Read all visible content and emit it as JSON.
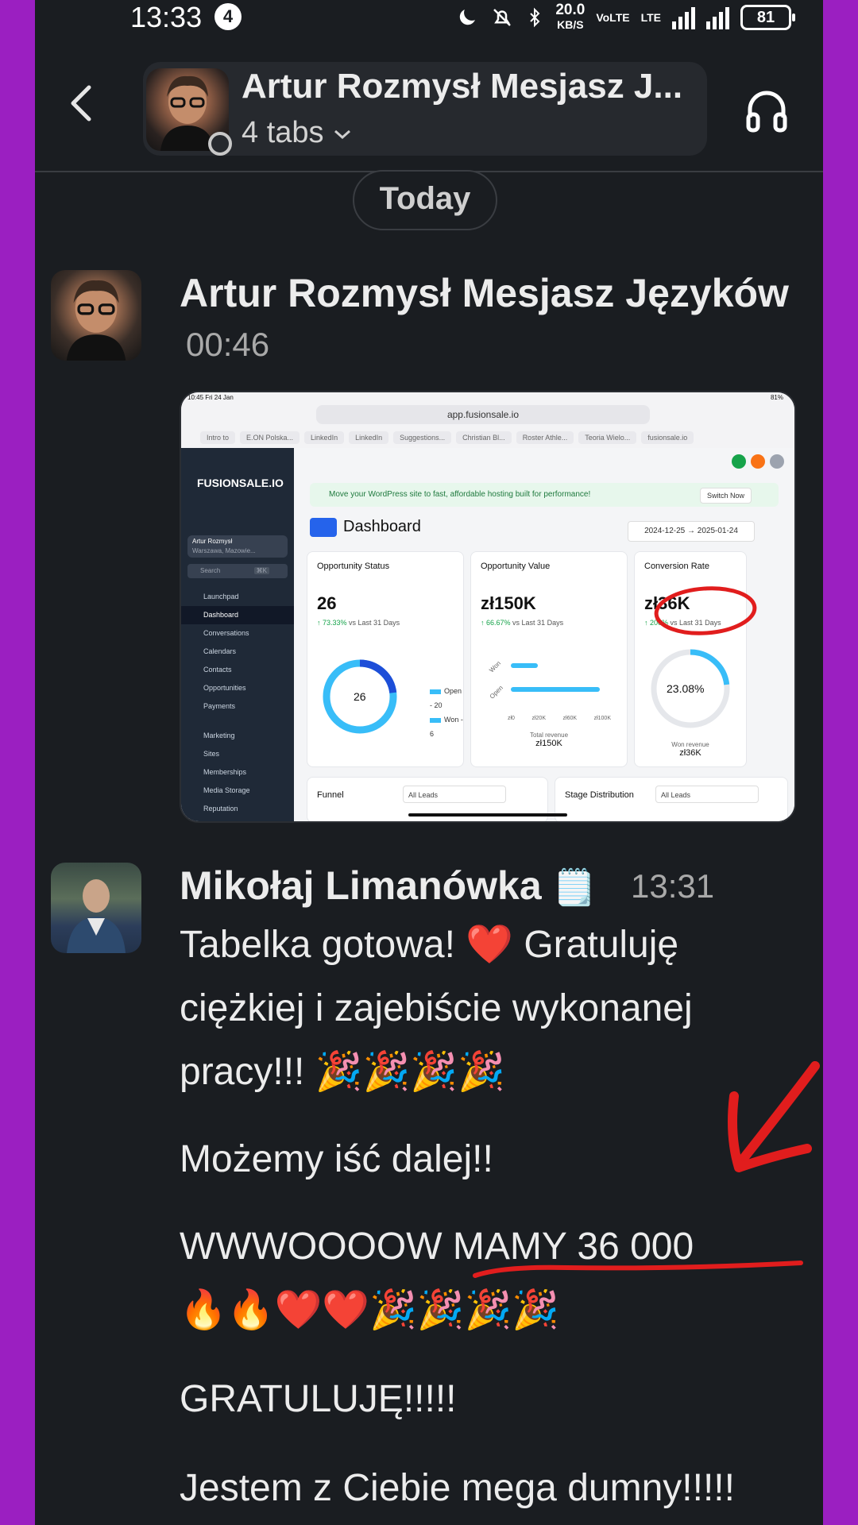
{
  "status_bar": {
    "time": "13:33",
    "notification_count": "4",
    "speed_value": "20.0",
    "speed_unit": "KB/S",
    "volte": "VoLTE",
    "lte": "LTE",
    "battery": "81"
  },
  "header": {
    "title": "Artur Rozmysł Mesjasz J...",
    "subtitle": "4 tabs"
  },
  "date_divider": "Today",
  "messages": [
    {
      "author": "Artur Rozmysł Mesjasz Języków",
      "time": "00:46",
      "screenshot": {
        "status_time": "10:45  Fri 24 Jan",
        "url": "app.fusionsale.io",
        "battery": "81%",
        "tabs": [
          "Intro to",
          "E.ON Polska...",
          "LinkedIn",
          "LinkedIn",
          "Suggestions...",
          "Christian Bl...",
          "Roster Athle...",
          "Teoria Wielo...",
          "fusionsale.io"
        ],
        "logo": "FUSIONSALE.IO",
        "user_name": "Artur Rozmysł",
        "user_location": "Warszawa, Mazowie...",
        "search_placeholder": "Search",
        "search_shortcut": "⌘K",
        "nav_items": [
          "Launchpad",
          "Dashboard",
          "Conversations",
          "Calendars",
          "Contacts",
          "Opportunities",
          "Payments"
        ],
        "nav_items_2": [
          "Marketing",
          "Sites",
          "Memberships",
          "Media Storage",
          "Reputation"
        ],
        "banner": "Move your WordPress site to fast, affordable hosting built for performance!",
        "banner_button": "Switch Now",
        "page_title": "Dashboard",
        "date_from": "2024-12-25",
        "date_to": "2025-01-24",
        "cards": [
          {
            "title": "Opportunity Status",
            "value": "26",
            "change": "↑ 73.33%",
            "compare": "vs Last 31 Days",
            "donut_label": "26",
            "legend": [
              "Open - 20",
              "Won - 6"
            ]
          },
          {
            "title": "Opportunity Value",
            "value": "zł150K",
            "change": "↑ 66.67%",
            "compare": "vs Last 31 Days",
            "axis": [
              "zł0",
              "zł20K",
              "zł60K",
              "zł100K"
            ],
            "bar_labels": [
              "Won",
              "Open"
            ],
            "total_label": "Total revenue",
            "total_value": "zł150K"
          },
          {
            "title": "Conversion Rate",
            "value": "zł36K",
            "change": "↑ 200%",
            "compare": "vs Last 31 Days",
            "gauge_label": "23.08%",
            "won_label": "Won revenue",
            "won_value": "zł36K"
          }
        ],
        "bottom_cards": [
          {
            "title": "Funnel",
            "select": "All Leads"
          },
          {
            "title": "Stage Distribution",
            "select": "All Leads"
          }
        ]
      }
    },
    {
      "author": "Mikołaj Limanówka",
      "author_emoji": "🗒️",
      "time": "13:31",
      "lines": [
        "Tabelka gotowa! ❤️ Gratuluję",
        "ciężkiej i zajebiście wykonanej",
        "pracy!!! 🎉🎉🎉🎉",
        "Możemy iść dalej!!",
        "WWWOOOOW MAMY 36 000",
        "🔥🔥❤️❤️🎉🎉🎉🎉",
        "GRATULUJĘ!!!!!",
        "Jestem z Ciebie mega dumny!!!!!"
      ]
    }
  ],
  "colors": {
    "frame": "#9b1fc1",
    "background": "#1a1d21",
    "annotation_red": "#e11d1d"
  }
}
